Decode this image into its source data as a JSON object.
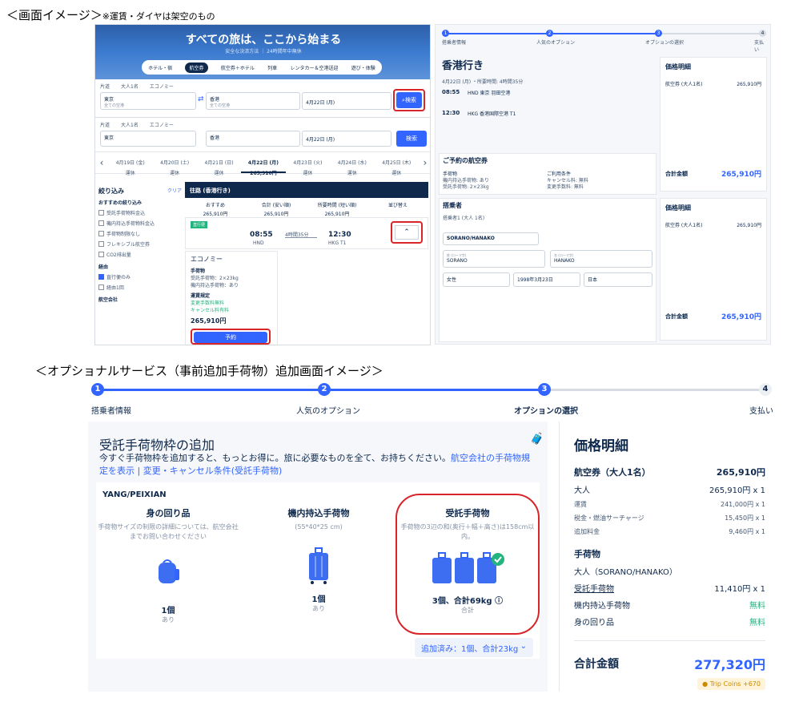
{
  "headings": {
    "screen_image": "＜画面イメージ＞",
    "screen_note": "※運賃・ダイヤは架空のもの",
    "option_image": "＜オプショナルサービス（事前追加手荷物）追加画面イメージ＞"
  },
  "search": {
    "hero_title": "すべての旅は、ここから始まる",
    "hero_sub": "安全な決済方法 ｜ 24時間年中無休",
    "nav": [
      "ホテル・宿",
      "航空券",
      "航空券＋ホテル",
      "列車",
      "レンタカー＆空港送迎",
      "遊び・体験"
    ],
    "nav_active": "航空券",
    "trip_type": "片道",
    "pax": "大人1名",
    "cabin": "エコノミー",
    "from": "東京",
    "from_sub": "全ての空港",
    "to": "香港",
    "to_sub": "全ての空港",
    "return_placeholder": "復路日を追加",
    "date": "4月22日 (月)",
    "search_button": "検索"
  },
  "results": {
    "dates": [
      {
        "d": "4月19日 (金)",
        "p": "運休"
      },
      {
        "d": "4月20日 (土)",
        "p": "運休"
      },
      {
        "d": "4月21日 (日)",
        "p": "運休"
      },
      {
        "d": "4月22日 (月)",
        "p": "265,910円"
      },
      {
        "d": "4月23日 (火)",
        "p": "運休"
      },
      {
        "d": "4月24日 (水)",
        "p": "運休"
      },
      {
        "d": "4月25日 (木)",
        "p": "運休"
      }
    ],
    "filter_title": "絞り込み",
    "clear": "クリア",
    "filters_hdr": "おすすめの絞り込み",
    "filters": [
      "受託手荷物料金込",
      "機内持込手荷物料金込",
      "手荷物制限なし",
      "フレキシブル航空券",
      "CO2排出量"
    ],
    "stops_hdr": "経由",
    "stops": [
      "直行便のみ",
      "経由1回"
    ],
    "airline_hdr": "航空会社",
    "outbound_title": "往路 (香港行き)",
    "tabs": [
      {
        "t": "おすすめ",
        "p": "265,910円"
      },
      {
        "t": "合計 (安い順)",
        "p": "265,910円"
      },
      {
        "t": "所要時間 (短い順)",
        "p": "265,910円"
      },
      {
        "t": "並び替え",
        "p": ""
      }
    ],
    "dep_time": "08:55",
    "dep_airport": "HND",
    "duration": "4時間35分",
    "direct": "直行便",
    "arr_time": "12:30",
    "arr_airport": "HKG T1",
    "fare_name": "エコノミー",
    "bag_hdr": "手荷物",
    "bag1": "受託手荷物：2×23kg",
    "bag2": "機内持込手荷物：あり",
    "rule_hdr": "運賃規定",
    "rule1": "変更手数料無料",
    "rule2": "キャンセル料有料",
    "fare_price": "265,910円",
    "book_button": "予約"
  },
  "booking": {
    "steps": [
      "搭乗者情報",
      "人気のオプション",
      "オプションの選択",
      "支払い"
    ],
    "dest_title": "香港行き",
    "seg_date": "4月22日 (月) ・所要時間: 4時間35分",
    "dep_time": "08:55",
    "dep": "HND 東京 羽田空港",
    "arr_time": "12:30",
    "arr": "HKG 香港国際空港 T1",
    "your_ticket": "ご予約の航空券",
    "bag_lbl": "手荷物",
    "bag1": "機内持込手荷物: あり",
    "bag2": "受託手荷物: 2×23kg",
    "cond_lbl": "ご利用条件",
    "cond1": "キャンセル料: 無料",
    "cond2": "変更手数料: 無料",
    "pax_title": "搭乗者",
    "pax_lbl": "搭乗者1 (大人 1名)",
    "pax_name": "SORANO/HANAKO",
    "surname_lbl": "姓 (ローマ字)",
    "surname": "SORANO",
    "given_lbl": "名 (ローマ字)",
    "given": "HANAKO",
    "gender": "女性",
    "dob": "1998年3月23日",
    "nation": "日本",
    "price_title": "価格明細",
    "total_lbl": "合計金額",
    "total": "265,910円",
    "fare_lbl": "航空券 (大人1名)",
    "fare_val": "265,910円"
  },
  "option": {
    "steps": [
      {
        "n": "1",
        "l": "搭乗者情報"
      },
      {
        "n": "2",
        "l": "人気のオプション"
      },
      {
        "n": "3",
        "l": "オプションの選択"
      },
      {
        "n": "4",
        "l": "支払い"
      }
    ],
    "title": "受託手荷物枠の追加",
    "desc": "今すぐ手荷物枠を追加すると、もっとお得に。旅に必要なものを全て、お持ちください。",
    "link": "航空会社の手荷物規定を表示 | 変更・キャンセル条件(受託手荷物)",
    "pax": "YANG/PEIXIAN",
    "cols": [
      {
        "t": "身の回り品",
        "s": "手荷物サイズの制限の詳細については、航空会社までお問い合わせください",
        "q": "1個",
        "u": "あり"
      },
      {
        "t": "機内持込手荷物",
        "s": "(55*40*25 cm)",
        "q": "1個",
        "u": "あり"
      },
      {
        "t": "受託手荷物",
        "s": "手荷物の3辺の和(奥行＋幅＋高さ)は158cm以内。",
        "q": "3個、合計69kg",
        "u": "合計"
      }
    ],
    "added": "追加済み：1個、合計23kg",
    "price_title": "価格明細",
    "fare_lbl": "航空券（大人1名）",
    "fare_val": "265,910円",
    "adult_lbl": "大人",
    "adult_val": "265,910円 x 1",
    "base_lbl": "運賃",
    "base_val": "241,000円 x 1",
    "tax_lbl": "税金・燃油サーチャージ",
    "tax_val": "15,450円 x 1",
    "fee_lbl": "追加料金",
    "fee_val": "9,460円 x 1",
    "bag_hdr": "手荷物",
    "bag_pax": "大人（SORANO/HANAKO）",
    "checked_lbl": "受託手荷物",
    "checked_val": "11,410円 x 1",
    "carry_lbl": "機内持込手荷物",
    "carry_val": "無料",
    "personal_lbl": "身の回り品",
    "personal_val": "無料",
    "total_lbl": "合計金額",
    "total_val": "277,320円",
    "coins": "Trip Coins +670"
  },
  "colors": {
    "accent": "#3264ff",
    "navy": "#0f294d",
    "red": "#d7252a",
    "green": "#24b47e"
  }
}
